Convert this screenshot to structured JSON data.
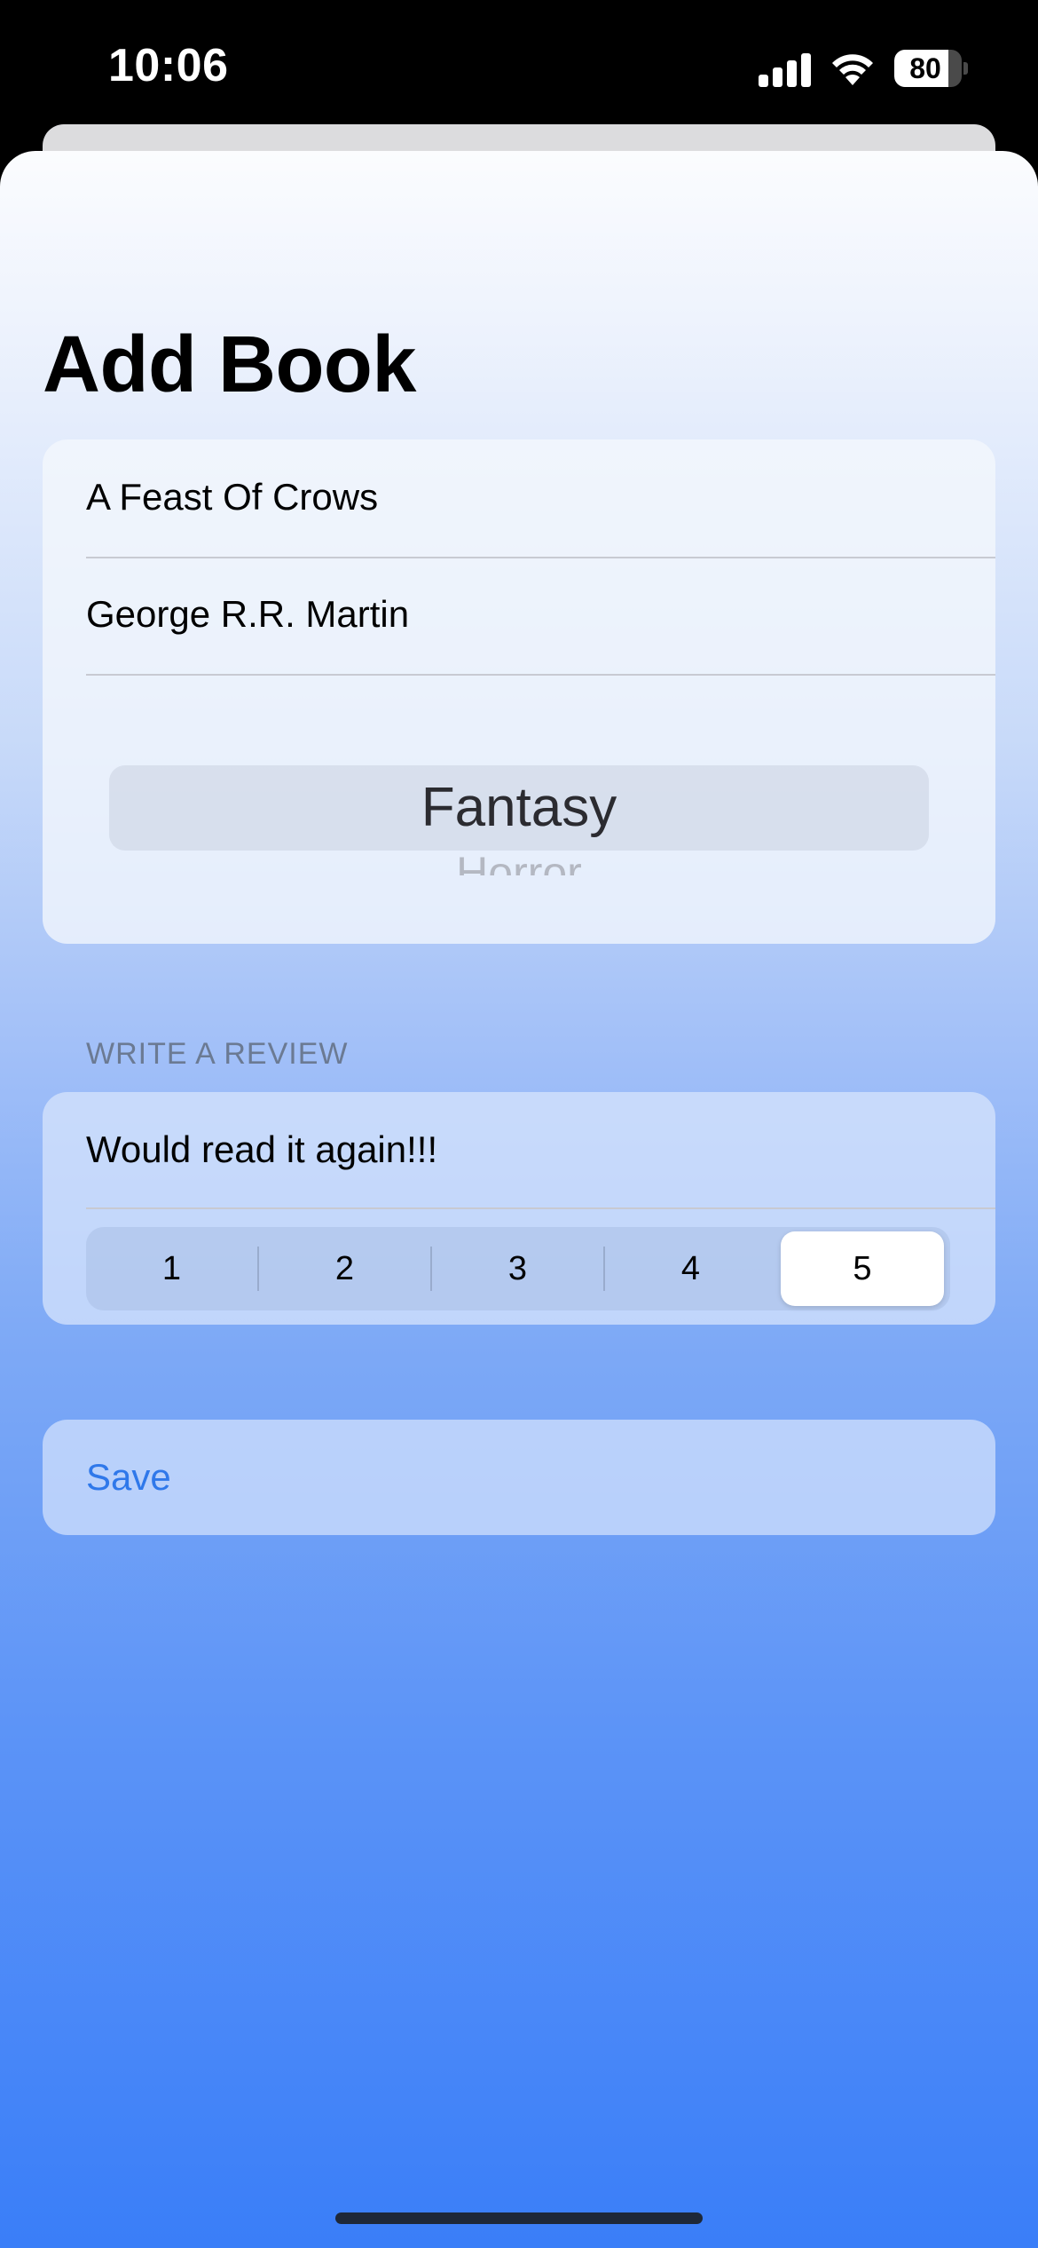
{
  "status_bar": {
    "time": "10:06",
    "battery_percent": "80",
    "battery_level": 0.8,
    "signal_bars_active": 3,
    "signal_bars_total": 4
  },
  "form": {
    "title": "Add Book",
    "book_title_value": "A Feast Of Crows",
    "author_value": "George R.R. Martin",
    "genre_picker": {
      "selected": "Fantasy",
      "next_partial": "Horror"
    },
    "review_section_header": "WRITE A REVIEW",
    "review_value": "Would read it again!!!",
    "rating": {
      "options": [
        "1",
        "2",
        "3",
        "4",
        "5"
      ],
      "selected": "5"
    },
    "save_label": "Save"
  },
  "colors": {
    "accent": "#2F78EA",
    "gradient_top": "#FBFCFE",
    "gradient_bottom": "#3A7EF8"
  }
}
